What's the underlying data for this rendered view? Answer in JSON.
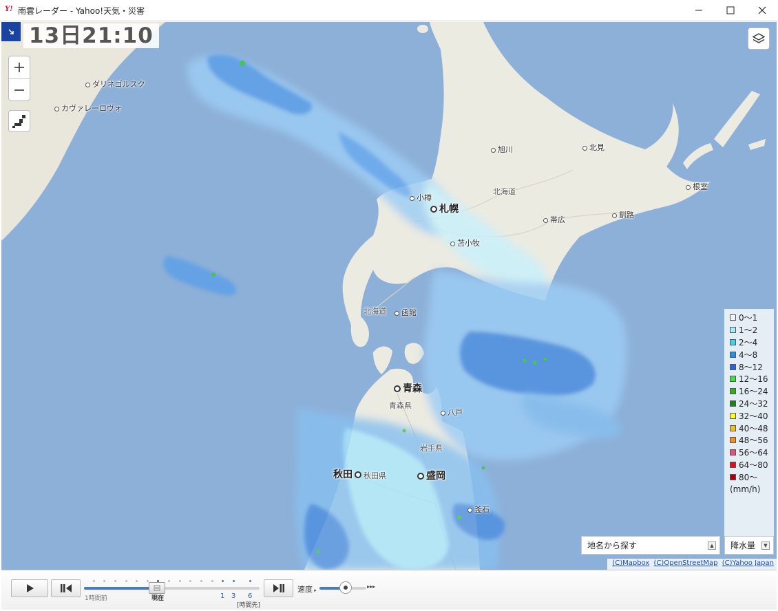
{
  "window": {
    "logo": "Y!",
    "title": "雨雲レーダー - Yahoo!天気・災害"
  },
  "map": {
    "timestamp": "13日21:10",
    "places": {
      "dalnegorsk": "ダリネゴルスク",
      "kavalerovo": "カヴァレーロヴォ",
      "asahikawa": "旭川",
      "kitami": "北見",
      "nemuro": "根室",
      "hokkaido": "北海道",
      "otaru": "小樽",
      "sapporo": "札幌",
      "obihiro": "帯広",
      "kushiro": "釧路",
      "tomakomai": "苫小牧",
      "hokkaido2": "北海道",
      "hakodate": "函館",
      "aomori": "青森",
      "aomori_pref": "青森県",
      "hachinohe": "八戸",
      "iwate_pref": "岩手県",
      "akita": "秋田",
      "akita_pref": "秋田県",
      "morioka": "盛岡",
      "kamaishi": "釜石"
    }
  },
  "legend": {
    "items": [
      {
        "label": "0～1",
        "color": "#f2f2ff"
      },
      {
        "label": "1～2",
        "color": "#a0f0ff"
      },
      {
        "label": "2～4",
        "color": "#40d0f0"
      },
      {
        "label": "4～8",
        "color": "#2090f0"
      },
      {
        "label": "8～12",
        "color": "#3060e0"
      },
      {
        "label": "12～16",
        "color": "#40e040"
      },
      {
        "label": "16～24",
        "color": "#30b020"
      },
      {
        "label": "24～32",
        "color": "#208020"
      },
      {
        "label": "32～40",
        "color": "#ffff30"
      },
      {
        "label": "40～48",
        "color": "#f0c020"
      },
      {
        "label": "48～56",
        "color": "#f09020"
      },
      {
        "label": "56～64",
        "color": "#e05080"
      },
      {
        "label": "64～80",
        "color": "#e01020"
      },
      {
        "label": "80～",
        "color": "#b00010"
      }
    ],
    "unit": "(mm/h)"
  },
  "search": {
    "label": "地名から探す"
  },
  "precip_select": {
    "label": "降水量"
  },
  "attribution": {
    "mapbox": "(C)Mapbox",
    "osm": "(C)OpenStreetMap",
    "yahoo": "(C)Yahoo Japan"
  },
  "timeline": {
    "label_past": "1時間前",
    "label_now": "現在",
    "label_1": "1",
    "label_3": "3",
    "label_6": "6",
    "label_future": "[時間先]",
    "progress": 0.42
  },
  "speed": {
    "label": "速度"
  }
}
